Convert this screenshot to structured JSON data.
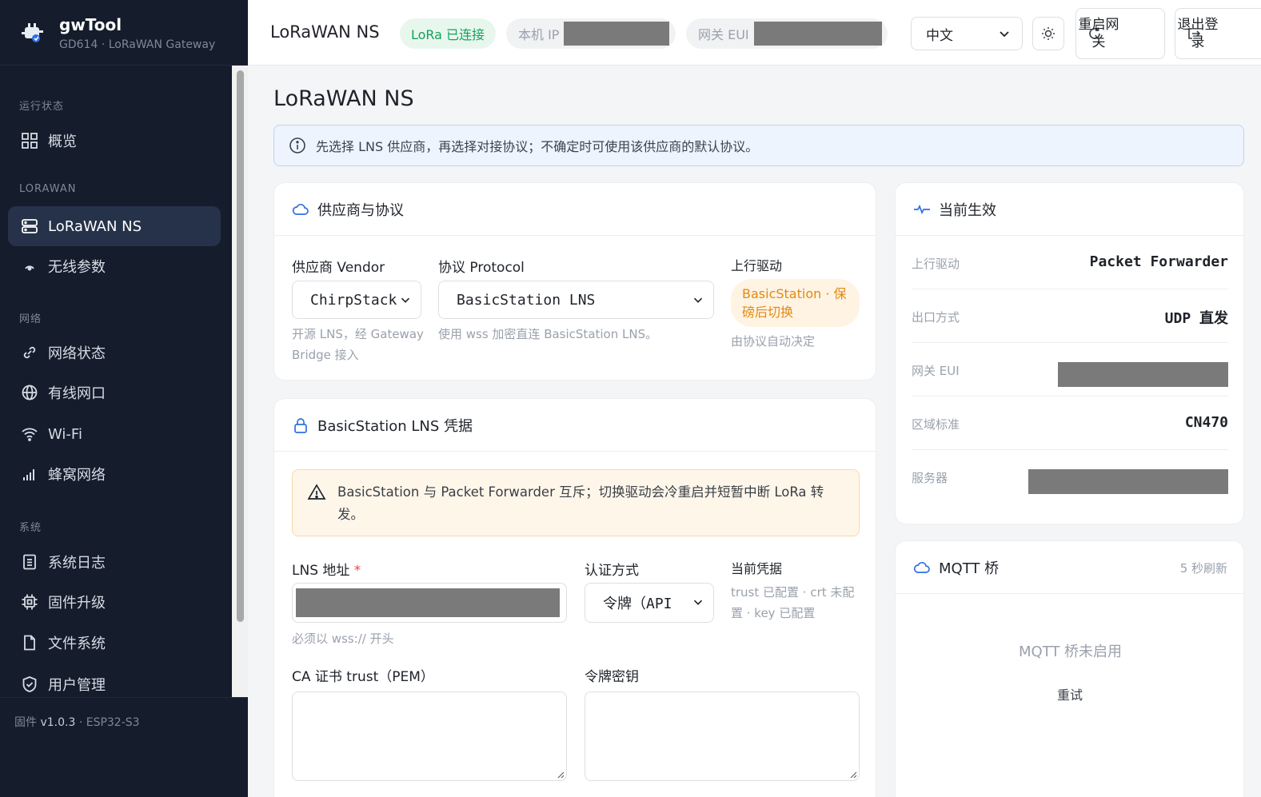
{
  "app": {
    "name": "gwTool",
    "subtitle": "GD614 · LoRaWAN Gateway",
    "firmware_label": "固件",
    "firmware_version": "v1.0.3",
    "firmware_chip": "· ESP32-S3"
  },
  "sidebar": {
    "sections": [
      {
        "label": "运行状态",
        "items": [
          {
            "label": "概览",
            "icon": "grid-icon"
          }
        ]
      },
      {
        "label": "LORAWAN",
        "items": [
          {
            "label": "LoRaWAN NS",
            "icon": "server-icon",
            "active": true
          },
          {
            "label": "无线参数",
            "icon": "antenna-icon"
          }
        ]
      },
      {
        "label": "网络",
        "items": [
          {
            "label": "网络状态",
            "icon": "link-icon"
          },
          {
            "label": "有线网口",
            "icon": "globe-icon"
          },
          {
            "label": "Wi-Fi",
            "icon": "wifi-icon"
          },
          {
            "label": "蜂窝网络",
            "icon": "signal-icon"
          }
        ]
      },
      {
        "label": "系统",
        "items": [
          {
            "label": "系统日志",
            "icon": "log-icon"
          },
          {
            "label": "固件升级",
            "icon": "chip-icon"
          },
          {
            "label": "文件系统",
            "icon": "file-icon"
          },
          {
            "label": "用户管理",
            "icon": "shield-icon"
          }
        ]
      }
    ]
  },
  "topbar": {
    "title": "LoRaWAN NS",
    "lora_status": "LoRa 已连接",
    "local_ip_label": "本机 IP",
    "gateway_eui_label": "网关 EUI",
    "language": "中文",
    "restart_label": "重启网关",
    "logout_label": "退出登录"
  },
  "page": {
    "title": "LoRaWAN NS",
    "info": "先选择 LNS 供应商，再选择对接协议；不确定时可使用该供应商的默认协议。"
  },
  "vendor_card": {
    "title": "供应商与协议",
    "vendor_label": "供应商 Vendor",
    "vendor_value": "ChirpStack",
    "vendor_help": "开源 LNS，经 Gateway Bridge 接入",
    "protocol_label": "协议 Protocol",
    "protocol_value": "BasicStation LNS",
    "protocol_help": "使用 wss 加密直连 BasicStation LNS。",
    "driver_label": "上行驱动",
    "driver_value": "BasicStation · 保磅后切换",
    "driver_help": "由协议自动决定"
  },
  "cred_card": {
    "title": "BasicStation LNS 凭据",
    "warning": "BasicStation 与 Packet Forwarder 互斥；切换驱动会冷重启并短暂中断 LoRa 转发。",
    "lns_label": "LNS 地址",
    "lns_required": "*",
    "lns_help": "必须以 wss:// 开头",
    "auth_label": "认证方式",
    "auth_value": "令牌（API",
    "cur_cred_label": "当前凭据",
    "cur_cred_value": "trust 已配置 · crt 未配置 · key 已配置",
    "ca_label": "CA 证书 trust（PEM）",
    "token_label": "令牌密钥"
  },
  "status_card": {
    "title": "当前生效",
    "rows": [
      {
        "key": "上行驱动",
        "value": "Packet Forwarder"
      },
      {
        "key": "出口方式",
        "value": "UDP 直发"
      },
      {
        "key": "网关 EUI",
        "value": ""
      },
      {
        "key": "区域标准",
        "value": "CN470"
      },
      {
        "key": "服务器",
        "value": ""
      }
    ]
  },
  "mqtt_card": {
    "title": "MQTT 桥",
    "refresh": "5 秒刷新",
    "status": "MQTT 桥未启用",
    "retry": "重试"
  },
  "colors": {
    "sidebar_bg": "#151c2b",
    "active_item": "#26324a",
    "success": "#14a35a",
    "warning": "#e08a12",
    "info_border": "#bcd3f5",
    "accent": "#2f6fe4"
  }
}
